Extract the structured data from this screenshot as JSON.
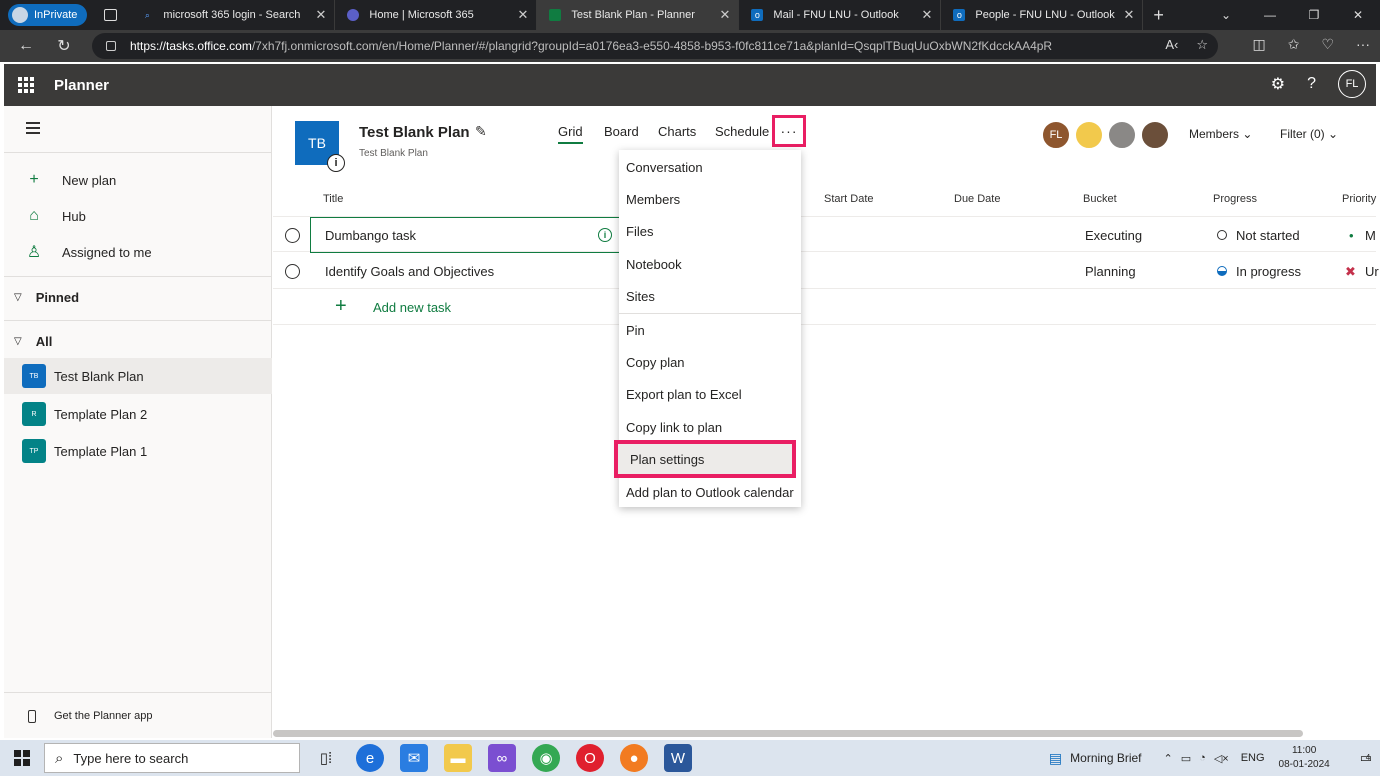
{
  "browser": {
    "inprivate_label": "InPrivate",
    "tabs": [
      {
        "title": "microsoft 365 login - Search",
        "active": false
      },
      {
        "title": "Home | Microsoft 365",
        "active": false
      },
      {
        "title": "Test Blank Plan - Planner",
        "active": true
      },
      {
        "title": "Mail - FNU LNU - Outlook",
        "active": false
      },
      {
        "title": "People - FNU LNU - Outlook",
        "active": false
      }
    ],
    "url_host": "https://tasks.office.com",
    "url_path": "/7xh7fj.onmicrosoft.com/en/Home/Planner/#/plangrid?groupId=a0176ea3-e550-4858-b953-f0fc811ce71a&planId=QsqplTBuqUuOxbWN2fKdcckAA4pR"
  },
  "app": {
    "name": "Planner",
    "user_initials": "FL"
  },
  "leftnav": {
    "new_plan": "New plan",
    "hub": "Hub",
    "assigned": "Assigned to me",
    "pinned": "Pinned",
    "all": "All",
    "plans": [
      {
        "initials": "TB",
        "name": "Test Blank Plan",
        "color": "#0f6cbd",
        "selected": true
      },
      {
        "initials": "R",
        "name": "Template Plan 2",
        "color": "#038387",
        "selected": false
      },
      {
        "initials": "TP",
        "name": "Template Plan 1",
        "color": "#038387",
        "selected": false
      }
    ],
    "get_app": "Get the Planner app"
  },
  "plan": {
    "initials": "TB",
    "title": "Test Blank Plan",
    "subtitle": "Test Blank Plan",
    "views": [
      "Grid",
      "Board",
      "Charts",
      "Schedule"
    ],
    "more": "···",
    "member_initials": "FL",
    "members_label": "Members",
    "filter_label": "Filter (0)"
  },
  "grid": {
    "columns": {
      "title": "Title",
      "start": "Start Date",
      "due": "Due Date",
      "bucket": "Bucket",
      "progress": "Progress",
      "priority": "Priority"
    },
    "rows": [
      {
        "title": "Dumbango task",
        "bucket": "Executing",
        "progress": "Not started",
        "priority": "M"
      },
      {
        "title": "Identify Goals and Objectives",
        "bucket": "Planning",
        "progress": "In progress",
        "priority": "Ur"
      }
    ],
    "add_task": "Add new task"
  },
  "menu": {
    "items": [
      "Conversation",
      "Members",
      "Files",
      "Notebook",
      "Sites",
      "Pin",
      "Copy plan",
      "Export plan to Excel",
      "Copy link to plan",
      "Plan settings",
      "Add plan to Outlook calendar"
    ],
    "highlighted": "Plan settings"
  },
  "taskbar": {
    "search_placeholder": "Type here to search",
    "weather": "Morning Brief",
    "lang": "ENG",
    "time": "11:00",
    "date": "08-01-2024",
    "notif_count": "4"
  },
  "colors": {
    "accent": "#107c41",
    "highlight": "#e91e63",
    "plan_blue": "#0f6cbd"
  }
}
